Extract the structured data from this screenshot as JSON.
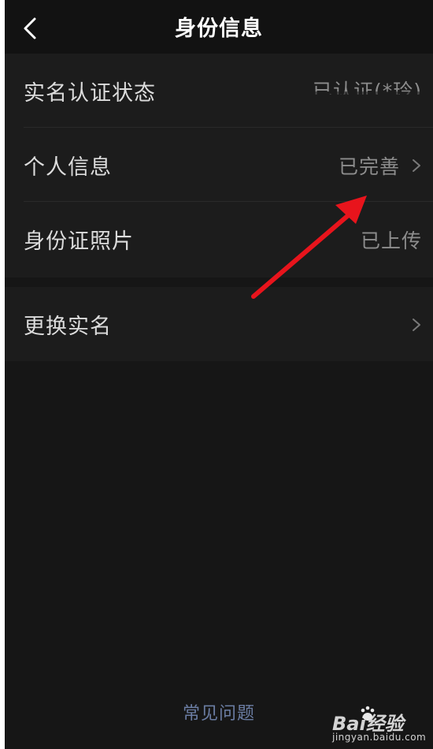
{
  "header": {
    "title": "身份信息",
    "back_icon": "chevron-left-icon"
  },
  "identity": {
    "rows": [
      {
        "label": "实名认证状态",
        "value": "已认证(*玲)"
      },
      {
        "label": "个人信息",
        "value": "已完善",
        "chevron": true
      },
      {
        "label": "身份证照片",
        "value": "已上传"
      }
    ]
  },
  "change_name": {
    "label": "更换实名",
    "chevron": true
  },
  "footer": {
    "faq_link": "常见问题"
  },
  "watermark": {
    "brand": "Bai经验",
    "url": "jingyan.baidu.com"
  },
  "colors": {
    "background": "#161616",
    "card": "#1c1c1c",
    "label_text": "#dcdcdc",
    "value_text": "#8d8d8d",
    "faq_link": "#6b7da3",
    "annotation_arrow": "#e8141c"
  }
}
